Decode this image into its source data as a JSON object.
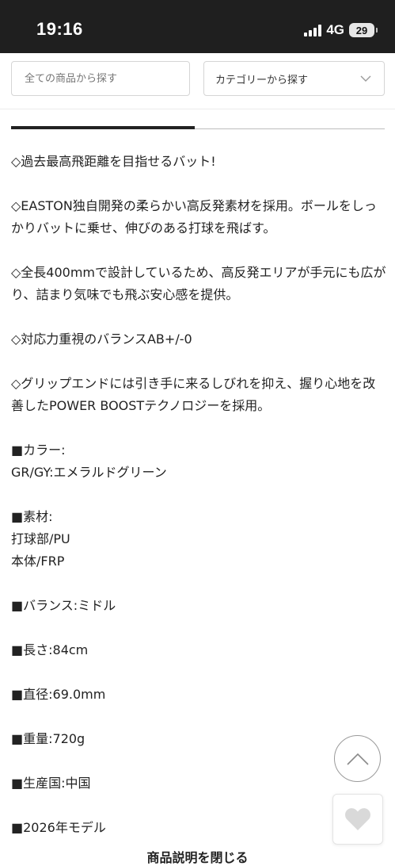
{
  "status_bar": {
    "time": "19:16",
    "network": "4G",
    "battery": "29"
  },
  "search": {
    "placeholder": "全ての商品から探す",
    "category_label": "カテゴリーから探す"
  },
  "description": {
    "paragraphs": [
      "◇過去最高飛距離を目指せるバット!",
      "◇EASTON独自開発の柔らかい高反発素材を採用。ボールをしっかりバットに乗せ、伸びのある打球を飛ばす。",
      "◇全長400mmで設計しているため、高反発エリアが手元にも広がり、詰まり気味でも飛ぶ安心感を提供。",
      "◇対応力重視のバランスAB+/-0",
      "◇グリップエンドには引き手に来るしびれを抑え、握り心地を改善したPOWER BOOSTテクノロジーを採用。"
    ],
    "specs": {
      "color_label": "■カラー:",
      "color_value": "GR/GY:エメラルドグリーン",
      "material_label": "■素材:",
      "material_value_1": "打球部/PU",
      "material_value_2": "本体/FRP",
      "balance": "■バランス:ミドル",
      "length": "■長さ:84cm",
      "diameter": "■直径:69.0mm",
      "weight": "■重量:720g",
      "origin": "■生産国:中国",
      "model_year": "■2026年モデル"
    }
  },
  "close_link": "商品説明を閉じる",
  "colors": {
    "status_bar_bg": "#1f1f1f",
    "text": "#222222",
    "placeholder": "#b8b8b8",
    "border": "#d5d5d5",
    "heart": "#d9d9d9"
  }
}
